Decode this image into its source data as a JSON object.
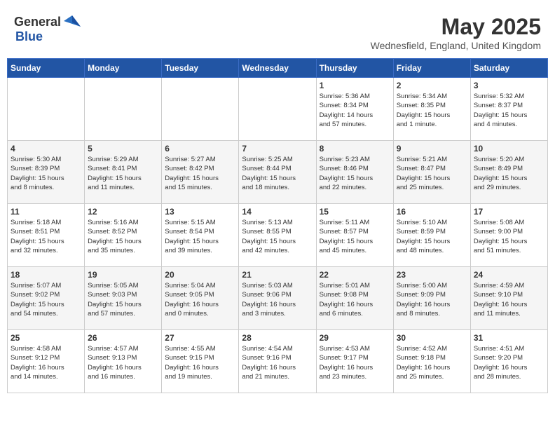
{
  "header": {
    "logo_general": "General",
    "logo_blue": "Blue",
    "main_title": "May 2025",
    "subtitle": "Wednesfield, England, United Kingdom"
  },
  "weekdays": [
    "Sunday",
    "Monday",
    "Tuesday",
    "Wednesday",
    "Thursday",
    "Friday",
    "Saturday"
  ],
  "weeks": [
    [
      {
        "day": "",
        "info": ""
      },
      {
        "day": "",
        "info": ""
      },
      {
        "day": "",
        "info": ""
      },
      {
        "day": "",
        "info": ""
      },
      {
        "day": "1",
        "info": "Sunrise: 5:36 AM\nSunset: 8:34 PM\nDaylight: 14 hours\nand 57 minutes."
      },
      {
        "day": "2",
        "info": "Sunrise: 5:34 AM\nSunset: 8:35 PM\nDaylight: 15 hours\nand 1 minute."
      },
      {
        "day": "3",
        "info": "Sunrise: 5:32 AM\nSunset: 8:37 PM\nDaylight: 15 hours\nand 4 minutes."
      }
    ],
    [
      {
        "day": "4",
        "info": "Sunrise: 5:30 AM\nSunset: 8:39 PM\nDaylight: 15 hours\nand 8 minutes."
      },
      {
        "day": "5",
        "info": "Sunrise: 5:29 AM\nSunset: 8:41 PM\nDaylight: 15 hours\nand 11 minutes."
      },
      {
        "day": "6",
        "info": "Sunrise: 5:27 AM\nSunset: 8:42 PM\nDaylight: 15 hours\nand 15 minutes."
      },
      {
        "day": "7",
        "info": "Sunrise: 5:25 AM\nSunset: 8:44 PM\nDaylight: 15 hours\nand 18 minutes."
      },
      {
        "day": "8",
        "info": "Sunrise: 5:23 AM\nSunset: 8:46 PM\nDaylight: 15 hours\nand 22 minutes."
      },
      {
        "day": "9",
        "info": "Sunrise: 5:21 AM\nSunset: 8:47 PM\nDaylight: 15 hours\nand 25 minutes."
      },
      {
        "day": "10",
        "info": "Sunrise: 5:20 AM\nSunset: 8:49 PM\nDaylight: 15 hours\nand 29 minutes."
      }
    ],
    [
      {
        "day": "11",
        "info": "Sunrise: 5:18 AM\nSunset: 8:51 PM\nDaylight: 15 hours\nand 32 minutes."
      },
      {
        "day": "12",
        "info": "Sunrise: 5:16 AM\nSunset: 8:52 PM\nDaylight: 15 hours\nand 35 minutes."
      },
      {
        "day": "13",
        "info": "Sunrise: 5:15 AM\nSunset: 8:54 PM\nDaylight: 15 hours\nand 39 minutes."
      },
      {
        "day": "14",
        "info": "Sunrise: 5:13 AM\nSunset: 8:55 PM\nDaylight: 15 hours\nand 42 minutes."
      },
      {
        "day": "15",
        "info": "Sunrise: 5:11 AM\nSunset: 8:57 PM\nDaylight: 15 hours\nand 45 minutes."
      },
      {
        "day": "16",
        "info": "Sunrise: 5:10 AM\nSunset: 8:59 PM\nDaylight: 15 hours\nand 48 minutes."
      },
      {
        "day": "17",
        "info": "Sunrise: 5:08 AM\nSunset: 9:00 PM\nDaylight: 15 hours\nand 51 minutes."
      }
    ],
    [
      {
        "day": "18",
        "info": "Sunrise: 5:07 AM\nSunset: 9:02 PM\nDaylight: 15 hours\nand 54 minutes."
      },
      {
        "day": "19",
        "info": "Sunrise: 5:05 AM\nSunset: 9:03 PM\nDaylight: 15 hours\nand 57 minutes."
      },
      {
        "day": "20",
        "info": "Sunrise: 5:04 AM\nSunset: 9:05 PM\nDaylight: 16 hours\nand 0 minutes."
      },
      {
        "day": "21",
        "info": "Sunrise: 5:03 AM\nSunset: 9:06 PM\nDaylight: 16 hours\nand 3 minutes."
      },
      {
        "day": "22",
        "info": "Sunrise: 5:01 AM\nSunset: 9:08 PM\nDaylight: 16 hours\nand 6 minutes."
      },
      {
        "day": "23",
        "info": "Sunrise: 5:00 AM\nSunset: 9:09 PM\nDaylight: 16 hours\nand 8 minutes."
      },
      {
        "day": "24",
        "info": "Sunrise: 4:59 AM\nSunset: 9:10 PM\nDaylight: 16 hours\nand 11 minutes."
      }
    ],
    [
      {
        "day": "25",
        "info": "Sunrise: 4:58 AM\nSunset: 9:12 PM\nDaylight: 16 hours\nand 14 minutes."
      },
      {
        "day": "26",
        "info": "Sunrise: 4:57 AM\nSunset: 9:13 PM\nDaylight: 16 hours\nand 16 minutes."
      },
      {
        "day": "27",
        "info": "Sunrise: 4:55 AM\nSunset: 9:15 PM\nDaylight: 16 hours\nand 19 minutes."
      },
      {
        "day": "28",
        "info": "Sunrise: 4:54 AM\nSunset: 9:16 PM\nDaylight: 16 hours\nand 21 minutes."
      },
      {
        "day": "29",
        "info": "Sunrise: 4:53 AM\nSunset: 9:17 PM\nDaylight: 16 hours\nand 23 minutes."
      },
      {
        "day": "30",
        "info": "Sunrise: 4:52 AM\nSunset: 9:18 PM\nDaylight: 16 hours\nand 25 minutes."
      },
      {
        "day": "31",
        "info": "Sunrise: 4:51 AM\nSunset: 9:20 PM\nDaylight: 16 hours\nand 28 minutes."
      }
    ]
  ]
}
